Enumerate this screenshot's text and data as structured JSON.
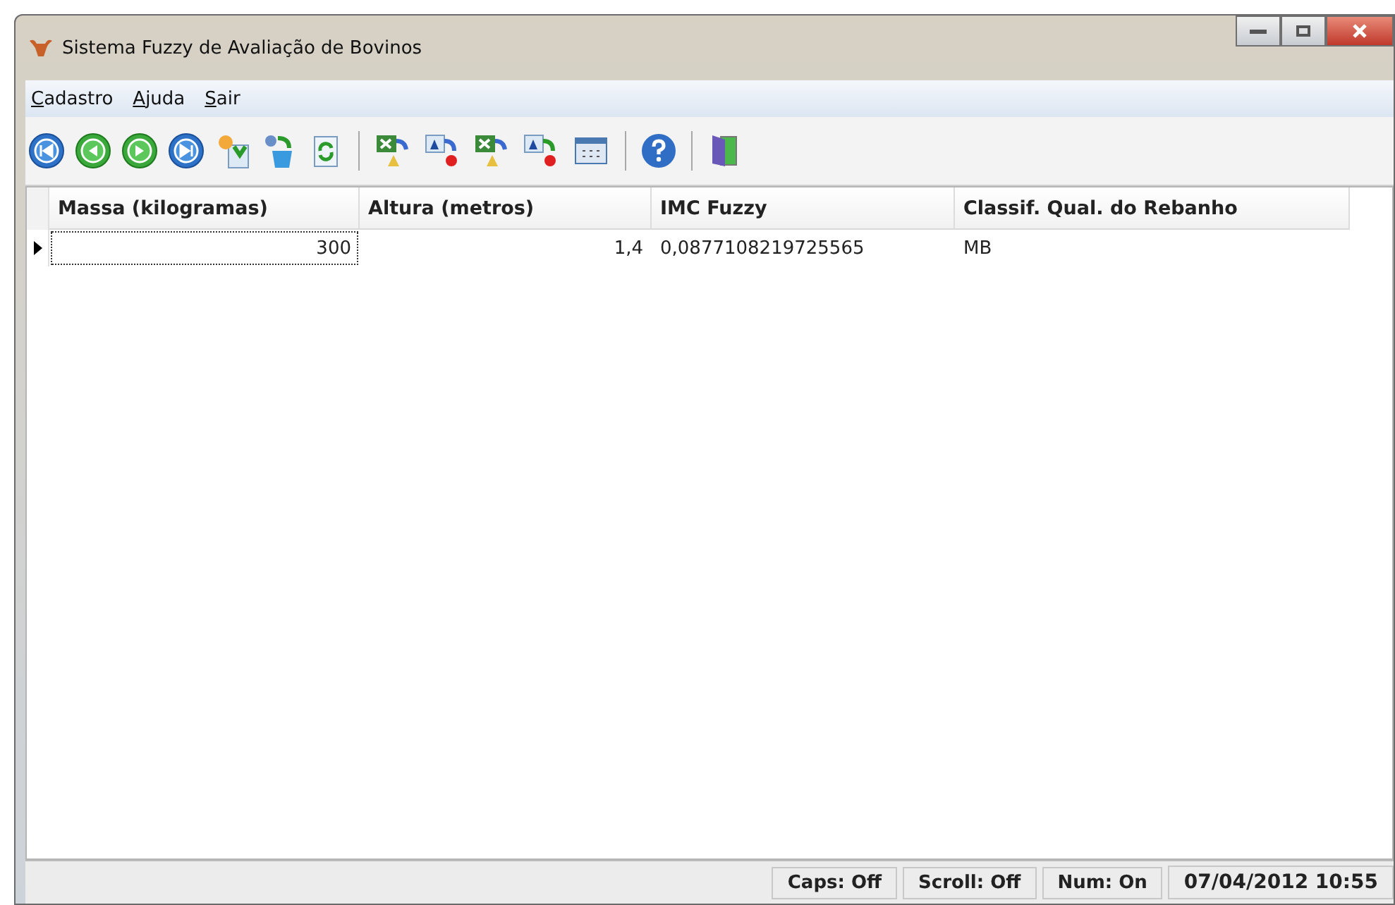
{
  "window": {
    "title": "Sistema Fuzzy de Avaliação de Bovinos"
  },
  "menu": [
    "Cadastro",
    "Ajuda",
    "Sair"
  ],
  "table": {
    "columns": [
      {
        "label": "Massa (kilogramas)"
      },
      {
        "label": "Altura (metros)"
      },
      {
        "label": "IMC Fuzzy"
      },
      {
        "label": "Classif. Qual. do Rebanho"
      }
    ],
    "rows": [
      {
        "selected": true,
        "cells": [
          "300",
          "1,4",
          "0,0877108219725565",
          "MB"
        ]
      }
    ]
  },
  "status_bar": [
    "Caps: Off",
    "Scroll: Off",
    "Num: On",
    "07/04/2012 10:55"
  ]
}
